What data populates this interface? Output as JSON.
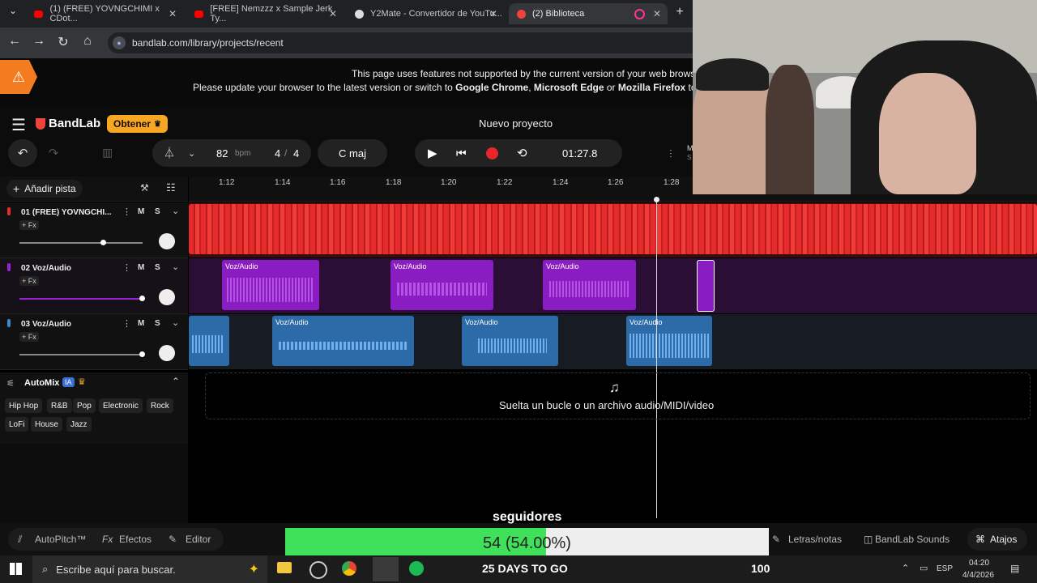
{
  "browser": {
    "tabs": [
      {
        "title": "(1) (FREE) YOVNGCHIMI x CDot...",
        "icon": "youtube-icon",
        "active": false
      },
      {
        "title": "[FREE] Nemzzz x Sample Jerk Ty...",
        "icon": "youtube-icon",
        "active": false
      },
      {
        "title": "Y2Mate - Convertidor de YouTu...",
        "icon": "y2mate-icon",
        "active": false
      },
      {
        "title": "(2) Biblioteca",
        "icon": "bandlab-icon",
        "active": true
      }
    ],
    "url": "bandlab.com/library/projects/recent"
  },
  "warning": {
    "line1": "This page uses features not supported by the current version of your web browse",
    "line2_pre": "Please update your browser to the latest version or switch to ",
    "chrome": "Google Chrome",
    "comma": ", ",
    "edge": "Microsoft Edge",
    "or": " or ",
    "firefox": "Mozilla Firefox",
    "line2_post": " to en"
  },
  "header": {
    "brand": "BandLab",
    "obtener": "Obtener",
    "project_title": "Nuevo proyecto",
    "bpm_value": "82",
    "bpm_unit": "bpm",
    "sig_num": "4",
    "sig_sep": "/",
    "sig_den": "4",
    "key": "C maj",
    "time": "01:27.8",
    "mix_initial": "M",
    "mix_sub": "S"
  },
  "sidebar": {
    "add_track": "Añadir pista",
    "automix": "AutoMix",
    "ia": "IA",
    "genres": [
      "Hip Hop",
      "R&B",
      "Pop",
      "Electronic",
      "Rock",
      "LoFi",
      "House",
      "Jazz"
    ]
  },
  "ruler": {
    "ticks": [
      "1:12",
      "1:14",
      "1:16",
      "1:18",
      "1:20",
      "1:22",
      "1:24",
      "1:26",
      "1:28"
    ]
  },
  "tracks": [
    {
      "name": "01  (FREE) YOVNGCHI...",
      "color": "#e52b2b",
      "fx": "+ Fx",
      "m": "M",
      "s": "S"
    },
    {
      "name": "02  Voz/Audio",
      "color": "#9b22d6",
      "fx": "+ Fx",
      "m": "M",
      "s": "S"
    },
    {
      "name": "03  Voz/Audio",
      "color": "#3d87d3",
      "fx": "+ Fx",
      "m": "M",
      "s": "S"
    }
  ],
  "clip_label": "Voz/Audio",
  "dropzone": "Suelta un bucle o un archivo audio/MIDI/video",
  "overlay": {
    "seguidores": "seguidores",
    "progress_text": "54 (54.00%)",
    "progress": 0.54,
    "days": "25 DAYS TO GO",
    "goal": "100"
  },
  "bottombar": {
    "autopitch": "AutoPitch™",
    "efectos": "Efectos",
    "editor": "Editor",
    "letras": "Letras/notas",
    "sounds": "BandLab Sounds",
    "atajos": "Atajos"
  },
  "taskbar": {
    "search": "Escribe aquí para buscar.",
    "lang": "ESP",
    "time": "04:20",
    "date": "4/4/2026"
  },
  "colors": {
    "accent_orange": "#f6a623",
    "record_red": "#e8262a",
    "progress_green": "#3fe05a"
  }
}
